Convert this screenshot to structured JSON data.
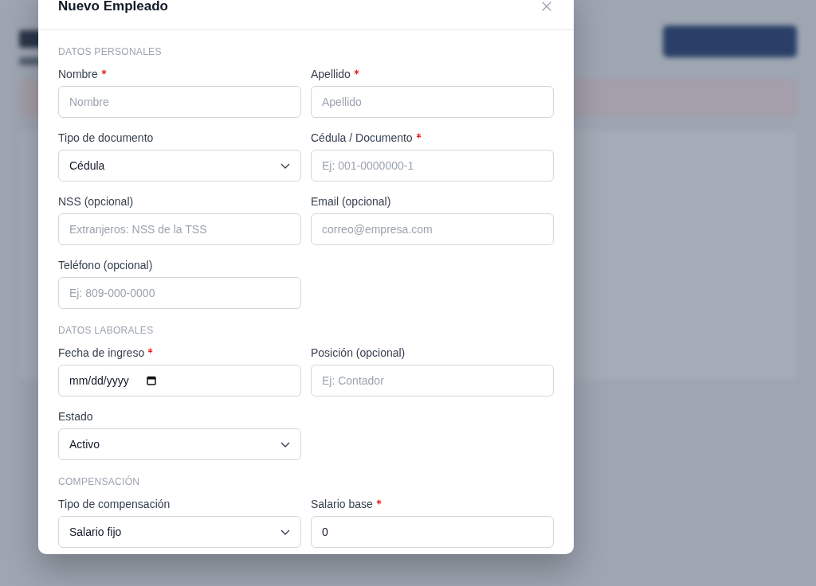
{
  "modal": {
    "title": "Nuevo Empleado",
    "sections": [
      {
        "heading": "DATOS PERSONALES",
        "fields": [
          {
            "label": "Nombre",
            "required": true,
            "kind": "text",
            "placeholder": "Nombre"
          },
          {
            "label": "Apellido",
            "required": true,
            "kind": "text",
            "placeholder": "Apellido"
          },
          {
            "label": "Tipo de documento",
            "required": false,
            "kind": "select",
            "value": "Cédula"
          },
          {
            "label": "Cédula / Documento",
            "required": true,
            "kind": "text",
            "placeholder": "Ej: 001-0000000-1"
          },
          {
            "label": "NSS (opcional)",
            "required": false,
            "kind": "text",
            "placeholder": "Extranjeros: NSS de la TSS"
          },
          {
            "label": "Email (opcional)",
            "required": false,
            "kind": "text",
            "placeholder": "correo@empresa.com"
          },
          {
            "label": "Teléfono (opcional)",
            "required": false,
            "kind": "text",
            "placeholder": "Ej: 809-000-0000"
          }
        ]
      },
      {
        "heading": "DATOS LABORALES",
        "fields": [
          {
            "label": "Fecha de ingreso",
            "required": true,
            "kind": "date",
            "value": "mm/dd/yyyy"
          },
          {
            "label": "Posición (opcional)",
            "required": false,
            "kind": "text",
            "placeholder": "Ej: Contador"
          },
          {
            "label": "Estado",
            "required": false,
            "kind": "select",
            "value": "Activo"
          }
        ]
      },
      {
        "heading": "COMPENSACIÓN",
        "fields": [
          {
            "label": "Tipo de compensación",
            "required": false,
            "kind": "select",
            "value": "Salario fijo"
          },
          {
            "label": "Salario base",
            "required": true,
            "kind": "text",
            "value": "0"
          }
        ]
      }
    ]
  }
}
